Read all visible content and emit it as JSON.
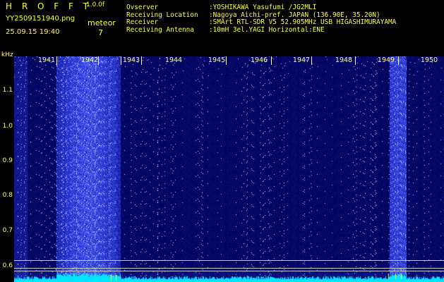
{
  "header": {
    "app_title": "H R O F F T",
    "version": "1.0.0f",
    "file_name": "YY2509151940.png",
    "date_time": "25.09.15 19:40",
    "meteor_label": "meteor",
    "meteor_count": "7"
  },
  "info": {
    "rows": [
      {
        "key": "Ovserver",
        "value": ":YOSHIKAWA Yasufumi /JG2MLI"
      },
      {
        "key": "Receiving Location",
        "value": ":Nagoya Aichi-pref. JAPAN (136.90E, 35.20N)"
      },
      {
        "key": "Receiver",
        "value": ":SMArt RTL-SDR V5 52.905MHz USB HIGASHIMURAYAMA"
      },
      {
        "key": "Receiving Antenna",
        "value": ":10mH 3el.YAGI Horizontal:ENE"
      }
    ]
  },
  "axis": {
    "unit": "kHz",
    "y_ticks": [
      {
        "label": "1.1",
        "value": 1.1
      },
      {
        "label": "1.0",
        "value": 1.0
      },
      {
        "label": "0.9",
        "value": 0.9
      },
      {
        "label": "0.8",
        "value": 0.8
      },
      {
        "label": "0.7",
        "value": 0.7
      },
      {
        "label": "0.6",
        "value": 0.6
      }
    ],
    "x_ticks": [
      {
        "label": "1941",
        "minute": 1
      },
      {
        "label": "1942",
        "minute": 2
      },
      {
        "label": "1943",
        "minute": 3
      },
      {
        "label": "1944",
        "minute": 4
      },
      {
        "label": "1945",
        "minute": 5
      },
      {
        "label": "1946",
        "minute": 6
      },
      {
        "label": "1947",
        "minute": 7
      },
      {
        "label": "1948",
        "minute": 8
      },
      {
        "label": "1949",
        "minute": 9
      },
      {
        "label": "1950",
        "minute": 10
      }
    ]
  },
  "colors": {
    "background": "#000000",
    "text": "#ffff33",
    "spectrum_base": "#1a1a80",
    "baseline": "#00e5ff"
  }
}
